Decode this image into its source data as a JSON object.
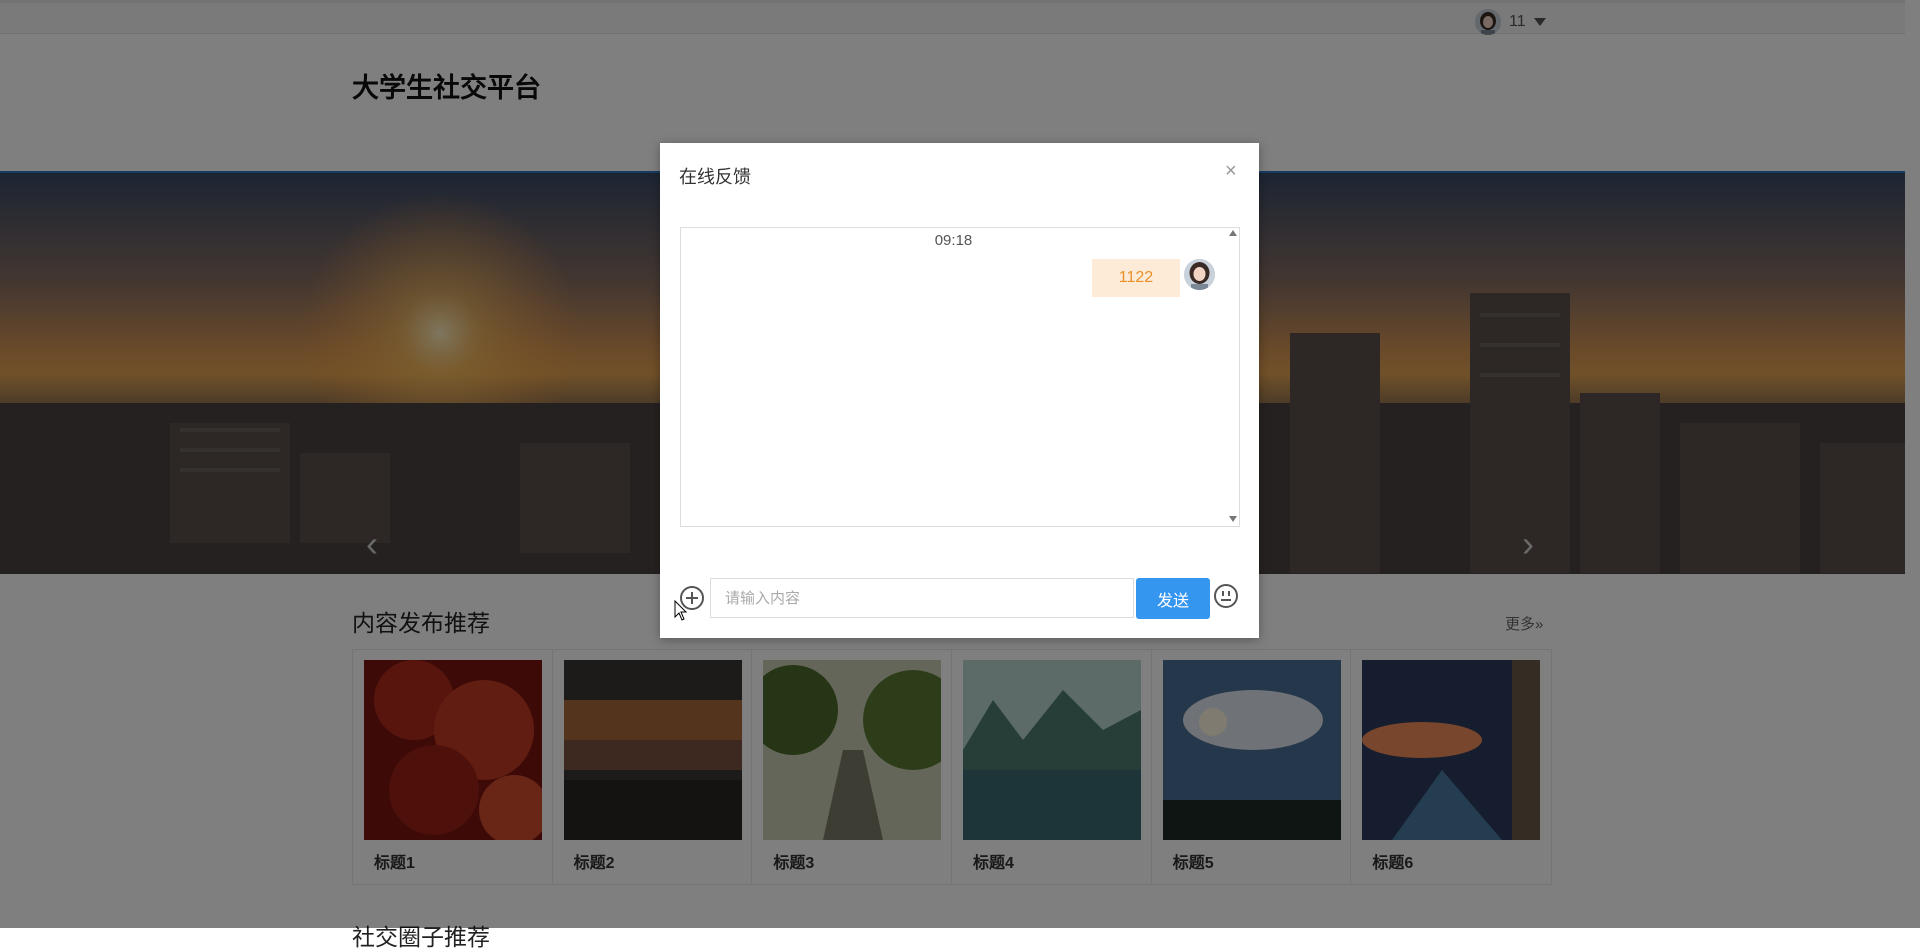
{
  "header": {
    "user_name": "11",
    "site_title": "大学生社交平台"
  },
  "banner": {
    "prev_glyph": "‹",
    "next_glyph": "›"
  },
  "recommend": {
    "section_title": "内容发布推荐",
    "more_label": "更多»",
    "cards": [
      {
        "title": "标题1"
      },
      {
        "title": "标题2"
      },
      {
        "title": "标题3"
      },
      {
        "title": "标题4"
      },
      {
        "title": "标题5"
      },
      {
        "title": "标题6"
      }
    ]
  },
  "next_section": {
    "title": "社交圈子推荐"
  },
  "dialog": {
    "title": "在线反馈",
    "close_glyph": "×",
    "messages": [
      {
        "time": "09:18",
        "text": "1122"
      }
    ],
    "input_placeholder": "请输入内容",
    "input_value": "",
    "send_label": "发送"
  },
  "colors": {
    "accent": "#3596f0",
    "bubble_bg": "#fdebd7",
    "bubble_text": "#e8912a",
    "banner_border": "#2e78c8"
  },
  "icons": [
    "avatar",
    "chevron-down-icon",
    "chevron-left-icon",
    "chevron-right-icon",
    "close-icon",
    "plus-circle-icon",
    "emoji-icon",
    "scroll-up-icon",
    "scroll-down-icon",
    "mouse-cursor"
  ]
}
